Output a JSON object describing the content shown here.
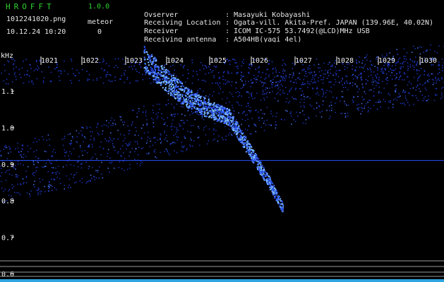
{
  "header": {
    "app_title": "HROFFT",
    "app_version": "1.0.0",
    "file_name": "1012241020.png",
    "meteor_label": "meteor",
    "datetime": "10.12.24 10:20",
    "meteor_count": "0"
  },
  "info": [
    {
      "key": "Ovserver",
      "value": "Masayuki Kobayashi"
    },
    {
      "key": "Receiving Location",
      "value": "Ogata-vill. Akita-Pref. JAPAN (139.96E, 40.02N)"
    },
    {
      "key": "Receiver",
      "value": "ICOM IC-575 53.7492(@LCD)MHz USB"
    },
    {
      "key": "Receiving antenna",
      "value": "A504HB(yagi 4el)"
    }
  ],
  "colors": {
    "background": "#000000",
    "header_green": "#2fd32f",
    "text_white": "#e8e8e8",
    "signal_blue": "#2a50ff",
    "signal_bright": "#6fb0ff"
  },
  "chart_data": {
    "type": "heatmap",
    "y_unit": "kHz",
    "x_ticks": [
      "1021",
      "1022",
      "1023",
      "1024",
      "1025",
      "1026",
      "1027",
      "1028",
      "1029",
      "1030"
    ],
    "y_ticks": [
      "1.1",
      "1.0",
      "0.9",
      "0.8",
      "0.7",
      "0.6"
    ],
    "x_range": [
      1020.3,
      1030.2
    ],
    "y_range": [
      0.577,
      1.195
    ],
    "carrier_line_khz": 0.91,
    "meteor_trace": [
      [
        1023.5,
        1.19
      ],
      [
        1024.0,
        1.13
      ],
      [
        1024.5,
        1.08
      ],
      [
        1025.0,
        1.05
      ],
      [
        1025.4,
        1.03
      ],
      [
        1025.7,
        0.97
      ],
      [
        1026.0,
        0.91
      ],
      [
        1026.3,
        0.85
      ],
      [
        1026.6,
        0.78
      ]
    ],
    "diffuse_band": [
      [
        1020.3,
        0.87
      ],
      [
        1022.0,
        0.92
      ],
      [
        1023.5,
        0.98
      ],
      [
        1025.0,
        1.04
      ],
      [
        1026.5,
        1.08
      ],
      [
        1028.0,
        1.11
      ],
      [
        1030.2,
        1.16
      ]
    ],
    "grid": false
  }
}
